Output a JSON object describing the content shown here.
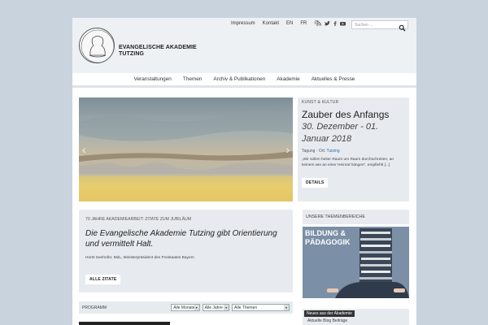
{
  "header": {
    "logo_line1": "EVANGELISCHE AKADEMIE",
    "logo_line2": "TUTZING",
    "top_links": [
      "Impressum",
      "Kontakt",
      "EN",
      "FR",
      "IT"
    ],
    "social_icons": [
      "rss-icon",
      "twitter-icon",
      "facebook-icon",
      "youtube-icon"
    ],
    "search_placeholder": "Suchen ..."
  },
  "nav": {
    "items": [
      "Veranstaltungen",
      "Themen",
      "Archiv & Publikationen",
      "Akademie",
      "Aktuelles & Presse"
    ]
  },
  "feature": {
    "category": "KUNST & KULTUR",
    "title": "Zauber des Anfangs",
    "date": "30. Dezember - 01. Januar 2018",
    "meta_prefix": "Tagung · Ort:",
    "meta_place": "Tutzing",
    "quote": "„Wir sollen heiter Raum um Raum durchschreiten, an keinem wie an einer Heimat hängen“, empfiehlt [...]",
    "button": "DETAILS"
  },
  "quote_box": {
    "heading": "70 JAHRE AKADEMIEARBEIT: ZITATE ZUM JUBILÄUM",
    "text": "Die Evangelische Akademie Tutzing gibt Orientierung und vermittelt Halt.",
    "author": "Horst Seehofer, MdL, Ministerpräsident des Freistaates Bayern",
    "button": "ALLE ZITATE"
  },
  "themen": {
    "heading": "UNSERE THEMENBEREICHE",
    "label_line1": "BILDUNG &",
    "label_line2": "PÄDAGOGIK"
  },
  "programm": {
    "label": "PROGRAMM",
    "selects": [
      "Alle Monate",
      "Alle Jahre",
      "Alle Themen"
    ]
  },
  "news": {
    "tag": "Neues aus der Akademie",
    "sub": "Aktuelle Blog Beiträge"
  },
  "colors": {
    "background": "#c9d3de",
    "panel": "#e7ebef",
    "link": "#2e6faa"
  }
}
